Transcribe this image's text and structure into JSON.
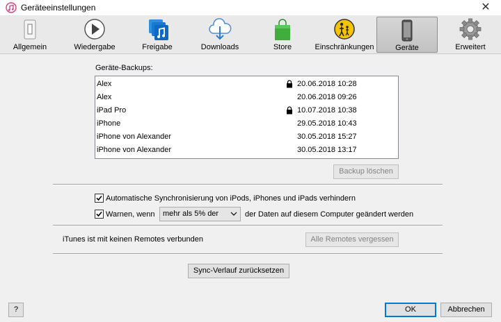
{
  "window": {
    "title": "Geräteeinstellungen",
    "close_glyph": "✕"
  },
  "toolbar": {
    "tabs": [
      {
        "label": "Allgemein",
        "icon": "switch-icon"
      },
      {
        "label": "Wiedergabe",
        "icon": "play-icon"
      },
      {
        "label": "Freigabe",
        "icon": "music-share-icon"
      },
      {
        "label": "Downloads",
        "icon": "cloud-download-icon"
      },
      {
        "label": "Store",
        "icon": "shopping-bag-icon"
      },
      {
        "label": "Einschränkungen",
        "icon": "parental-restriction-icon"
      },
      {
        "label": "Geräte",
        "icon": "device-phone-icon",
        "selected": true
      },
      {
        "label": "Erweitert",
        "icon": "gear-icon"
      }
    ]
  },
  "backups": {
    "label": "Geräte-Backups:",
    "rows": [
      {
        "name": "Alex",
        "locked": true,
        "date": "20.06.2018 10:28"
      },
      {
        "name": "Alex",
        "locked": false,
        "date": "20.06.2018 09:26"
      },
      {
        "name": "iPad Pro",
        "locked": true,
        "date": "10.07.2018 10:38"
      },
      {
        "name": "iPhone",
        "locked": false,
        "date": "29.05.2018 10:43"
      },
      {
        "name": "iPhone von Alexander",
        "locked": false,
        "date": "30.05.2018 15:27"
      },
      {
        "name": "iPhone von Alexander",
        "locked": false,
        "date": "30.05.2018 13:17"
      }
    ],
    "delete_button": "Backup löschen"
  },
  "sync": {
    "auto_sync_label": "Automatische Synchronisierung von iPods, iPhones und iPads verhindern",
    "auto_sync_checked": true,
    "warn_label": "Warnen, wenn",
    "warn_checked": true,
    "warn_select_value": "mehr als 5% der",
    "warn_suffix": "der Daten auf diesem Computer geändert werden"
  },
  "remotes": {
    "status": "iTunes ist mit keinen Remotes verbunden",
    "forget_button": "Alle Remotes vergessen"
  },
  "reset_button": "Sync-Verlauf zurücksetzen",
  "footer": {
    "help_button": "?",
    "ok_button": "OK",
    "cancel_button": "Abbrechen"
  }
}
